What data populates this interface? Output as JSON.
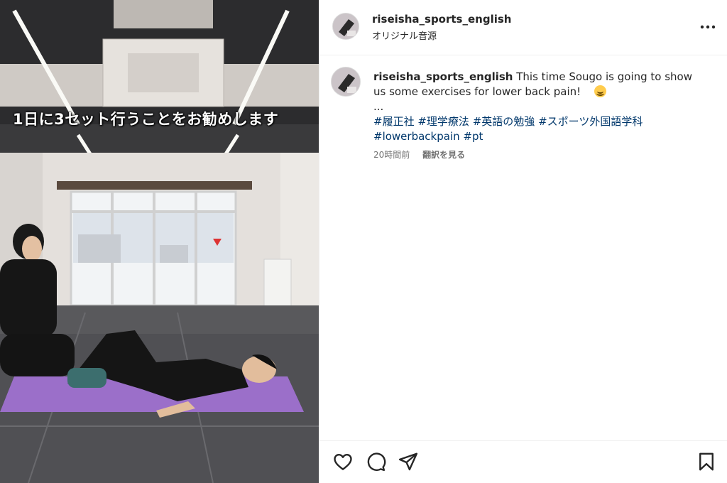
{
  "video": {
    "caption_text": "1日に3セット行うことをお勧めします"
  },
  "header": {
    "username": "riseisha_sports_english",
    "audio_label": "オリジナル音源",
    "more_icon": "more-options-icon"
  },
  "comment": {
    "username": "riseisha_sports_english",
    "text": "This time Sougo is going to show us some exercises for lower back pain!",
    "emoji": "smiling-face-icon",
    "ellipsis": "...",
    "hashtags": [
      "#履正社",
      "#理学療法",
      "#英語の勉強",
      "#スポーツ外国語学科",
      "#lowerbackpain",
      "#pt"
    ],
    "time": "20時間前",
    "translate_label": "翻訳を見る"
  },
  "actions": {
    "icons": [
      "heart-icon",
      "comment-icon",
      "share-icon",
      "bookmark-icon"
    ]
  },
  "colors": {
    "text": "#262626",
    "hashtag": "#00376b",
    "meta": "#737373",
    "divider": "#efefef",
    "mat": "#9b6fc9"
  }
}
